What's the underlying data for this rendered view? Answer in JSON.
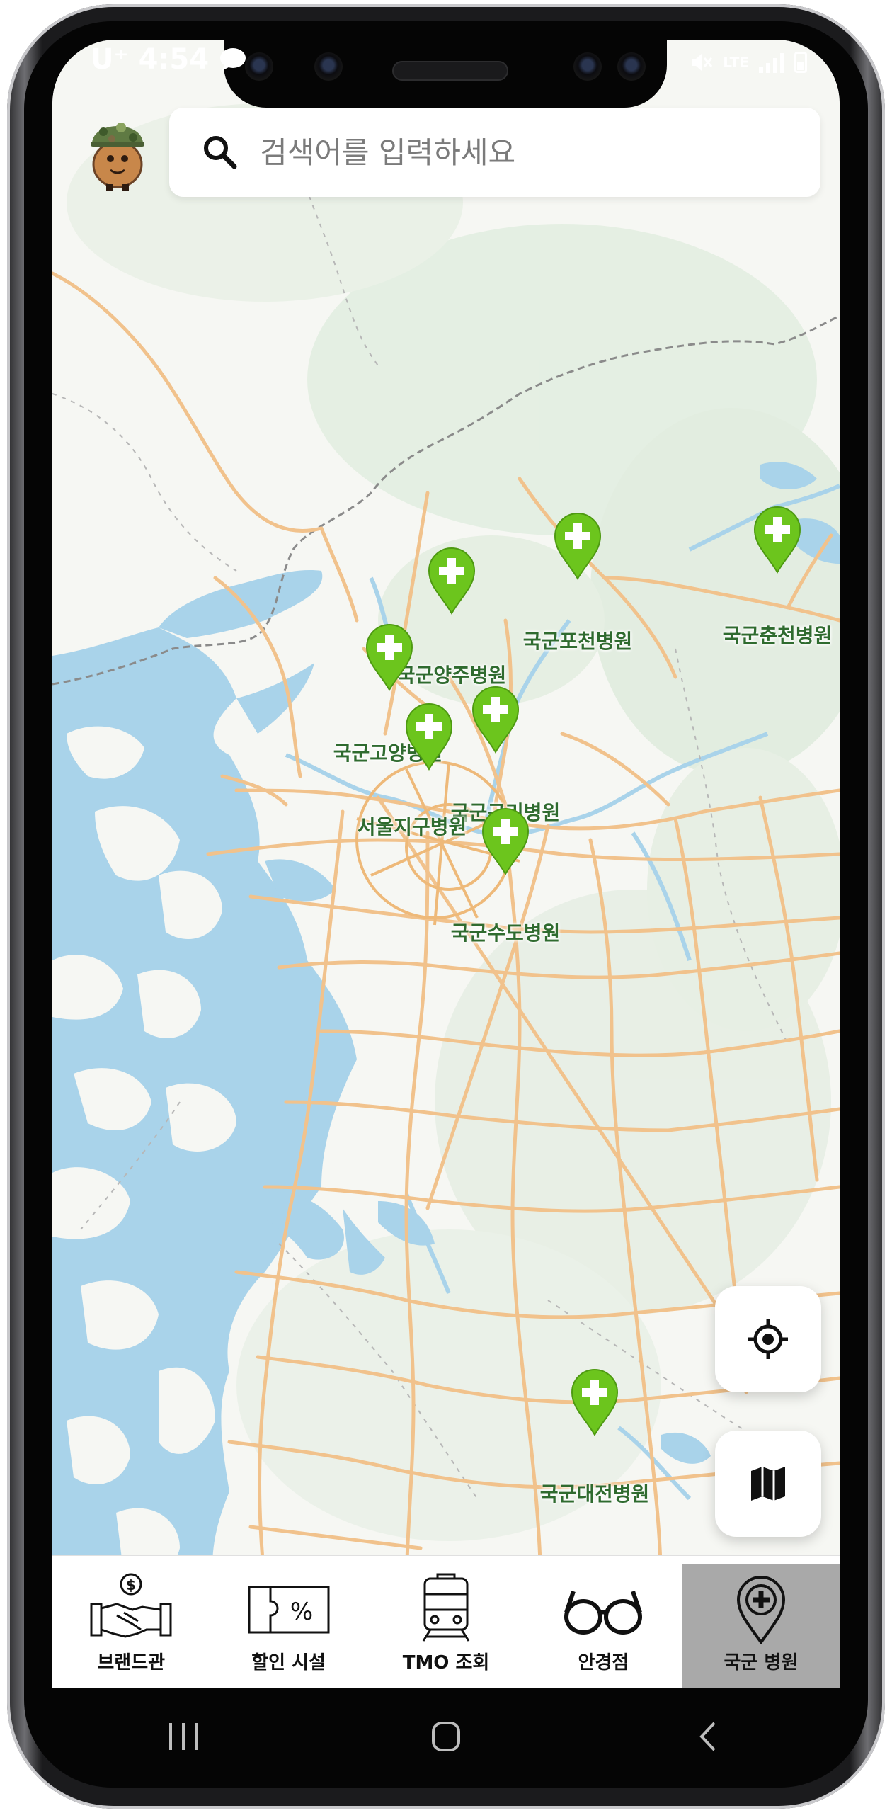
{
  "status_bar": {
    "carrier": "U⁺",
    "time": "4:54",
    "network": "LTE"
  },
  "search": {
    "placeholder": "검색어를 입력하세요"
  },
  "markers": [
    {
      "label": "국군포천병원"
    },
    {
      "label": "국군춘천병원"
    },
    {
      "label": "국군양주병원"
    },
    {
      "label": "국군고양병원"
    },
    {
      "label": "국군구리병원"
    },
    {
      "label": "서울지구병원"
    },
    {
      "label": "국군수도병원"
    },
    {
      "label": "국군대전병원"
    }
  ],
  "fabs": {
    "locate_icon": "crosshair-icon",
    "map_icon": "map-icon"
  },
  "bottom_nav": {
    "items": [
      {
        "label": "브랜드관",
        "icon": "handshake-dollar-icon"
      },
      {
        "label": "할인 시설",
        "icon": "ticket-percent-icon"
      },
      {
        "label": "TMO 조회",
        "icon": "train-icon"
      },
      {
        "label": "안경점",
        "icon": "glasses-icon"
      },
      {
        "label": "국군 병원",
        "icon": "hospital-pin-icon",
        "active": true
      }
    ]
  },
  "colors": {
    "marker_green": "#6cc51d",
    "label_green": "#2f6b2f",
    "water": "#a9d3ea",
    "road": "#f2c48a",
    "active_tab": "#a9a9a9"
  }
}
